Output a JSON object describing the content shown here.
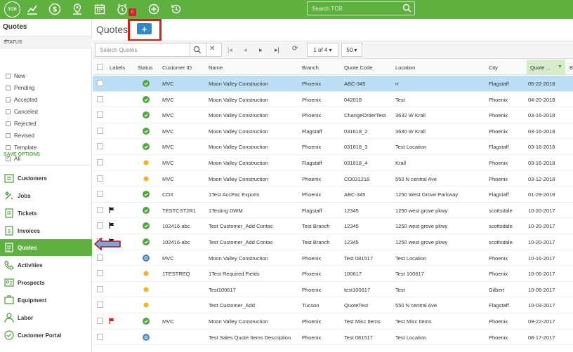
{
  "app": {
    "logo": "TCR"
  },
  "topbar": {
    "icons": [
      "chart-icon",
      "dollar-icon",
      "map-pin-icon",
      "calendar-icon",
      "alarm-clock-icon",
      "add-circle-icon",
      "history-icon"
    ],
    "alarm_badge": "0",
    "search_placeholder": "Search TCR"
  },
  "sidebar": {
    "title": "Quotes",
    "status_header": "STATUS",
    "statuses": [
      {
        "label": "New",
        "checked": false
      },
      {
        "label": "Pending",
        "checked": false
      },
      {
        "label": "Accepted",
        "checked": false
      },
      {
        "label": "Canceled",
        "checked": false
      },
      {
        "label": "Rejected",
        "checked": false
      },
      {
        "label": "Revised",
        "checked": false
      },
      {
        "label": "Template",
        "checked": false
      },
      {
        "label": "All",
        "checked": true
      }
    ],
    "save_options": "SAVE OPTIONS",
    "nav": [
      {
        "label": "Customers",
        "icon": "customers-icon"
      },
      {
        "label": "Jobs",
        "icon": "tools-icon"
      },
      {
        "label": "Tickets",
        "icon": "ticket-icon"
      },
      {
        "label": "Invoices",
        "icon": "invoice-icon"
      },
      {
        "label": "Quotes",
        "icon": "quote-icon",
        "active": true
      },
      {
        "label": "Activities",
        "icon": "phone-icon"
      },
      {
        "label": "Prospects",
        "icon": "prospects-icon"
      },
      {
        "label": "Equipment",
        "icon": "equipment-icon"
      },
      {
        "label": "Labor",
        "icon": "labor-icon"
      },
      {
        "label": "Customer Portal",
        "icon": "portal-icon"
      }
    ]
  },
  "main": {
    "title": "Quotes",
    "add_button": "+",
    "search_placeholder": "Search Quotes",
    "page_label": "1 of 4 ▾",
    "page_size": "50 ▾"
  },
  "table": {
    "columns": [
      "Labels",
      "Status",
      "Customer ID",
      "Name",
      "Branch",
      "Quote Code",
      "Location",
      "City",
      "Quote ...",
      "B"
    ],
    "rows": [
      {
        "flag": "",
        "status": "green",
        "customer_id": "MVC",
        "name": "Moon Valley Construction",
        "branch": "Phoenix",
        "quote_code": "ABC-345",
        "location": "rr",
        "city": "Flagstaff",
        "date": "05-22-2018",
        "selected": true
      },
      {
        "flag": "",
        "status": "green",
        "customer_id": "MVC",
        "name": "Moon Valley Construction",
        "branch": "Phoenix",
        "quote_code": "042018",
        "location": "Test",
        "city": "Phoenix",
        "date": "04-20-2018"
      },
      {
        "flag": "",
        "status": "green",
        "customer_id": "MVC",
        "name": "Moon Valley Construction",
        "branch": "Phoenix",
        "quote_code": "ChangeOrderTest",
        "location": "3632 W Krall",
        "city": "Phoenix",
        "date": "03-16-2018"
      },
      {
        "flag": "",
        "status": "green",
        "customer_id": "MVC",
        "name": "Moon Valley Construction",
        "branch": "Flagstaff",
        "quote_code": "031618_2",
        "location": "3630 W Krall",
        "city": "Phoenix",
        "date": "03-16-2018"
      },
      {
        "flag": "",
        "status": "green",
        "customer_id": "MVC",
        "name": "Moon Valley Construction",
        "branch": "Phoenix",
        "quote_code": "031618_3",
        "location": "Test Location",
        "city": "Flagstaff",
        "date": "03-16-2018"
      },
      {
        "flag": "",
        "status": "yellow",
        "customer_id": "MVC",
        "name": "Moon Valley Construction",
        "branch": "Flagstaff",
        "quote_code": "031618_4",
        "location": "Krall",
        "city": "Phoenix",
        "date": "03-16-2018"
      },
      {
        "flag": "",
        "status": "yellow",
        "customer_id": "MVC",
        "name": "Moon Valley Construction",
        "branch": "Phoenix",
        "quote_code": "CO031218",
        "location": "550 N central Ave",
        "city": "Phoenix",
        "date": "03-12-2018"
      },
      {
        "flag": "",
        "status": "green",
        "customer_id": "COX",
        "name": "1Test AccPac Exports",
        "branch": "Phoenix",
        "quote_code": "ABC-345",
        "location": "1250 West Grove Parkway",
        "city": "Flagstaff",
        "date": "01-29-2018"
      },
      {
        "flag": "black",
        "status": "green",
        "customer_id": "TESTCST2R1",
        "name": "1Testing DWM",
        "branch": "Flagstaff",
        "quote_code": "12345",
        "location": "1250 west grove pkwy",
        "city": "scottsdale",
        "date": "10-20-2017"
      },
      {
        "flag": "black",
        "status": "green",
        "customer_id": "102416-abc",
        "name": "Test Customer_Add Contac",
        "branch": "Test Branch",
        "quote_code": "12345",
        "location": "1250 west grove pkwy",
        "city": "scottsdale",
        "date": "10-20-2017"
      },
      {
        "flag": "black",
        "status": "green",
        "customer_id": "102416-abc",
        "name": "Test Customer_Add Contac",
        "branch": "Test Branch",
        "quote_code": "12345",
        "location": "1250 west grove pkwy",
        "city": "scottsdale",
        "date": "10-20-2017"
      },
      {
        "flag": "",
        "status": "blue",
        "customer_id": "MVC",
        "name": "Moon Valley Construction",
        "branch": "Phoenix",
        "quote_code": "Test 081517",
        "location": "Test Location",
        "city": "Phoenix",
        "date": "10-16-2017"
      },
      {
        "flag": "",
        "status": "yellow",
        "customer_id": "1TESTREQ",
        "name": "1Test Required Fields",
        "branch": "Phoenix",
        "quote_code": "100617",
        "location": "Test 100617",
        "city": "Phoenix",
        "date": "10-06-2017"
      },
      {
        "flag": "",
        "status": "yellow",
        "customer_id": "",
        "name": "Test100617",
        "branch": "Phoenix",
        "quote_code": "test100617",
        "location": "Test",
        "city": "Gilbert",
        "date": "10-06-2017"
      },
      {
        "flag": "",
        "status": "yellow",
        "customer_id": "",
        "name": "Test Customer_Add",
        "branch": "Tucson",
        "quote_code": "QuoteTest",
        "location": "550 N central Ave",
        "city": "Flagstaff",
        "date": "10-03-2017"
      },
      {
        "flag": "red",
        "status": "green",
        "customer_id": "MVC",
        "name": "Moon Valley Construction",
        "branch": "Phoenix",
        "quote_code": "Test Misc Items",
        "location": "Test Misc Items",
        "city": "Phoenix",
        "date": "09-22-2017"
      },
      {
        "flag": "",
        "status": "blue",
        "customer_id": "",
        "name": "Test Sales Quote Items Description",
        "branch": "Phoenix",
        "quote_code": "Test 081517",
        "location": "Test Location",
        "city": "Phoenix",
        "date": "08-17-2017"
      }
    ]
  },
  "colors": {
    "accent": "#5fb13f",
    "selected_row": "#bcdff6",
    "add_button": "#2e89c6",
    "highlight_box": "#e01a1a",
    "arrow": "#c0141c",
    "status_green": "#4fa83b",
    "status_yellow": "#f3b51b",
    "status_blue": "#4a8cc5",
    "flag_black": "#222222",
    "flag_red": "#e01a1a"
  }
}
